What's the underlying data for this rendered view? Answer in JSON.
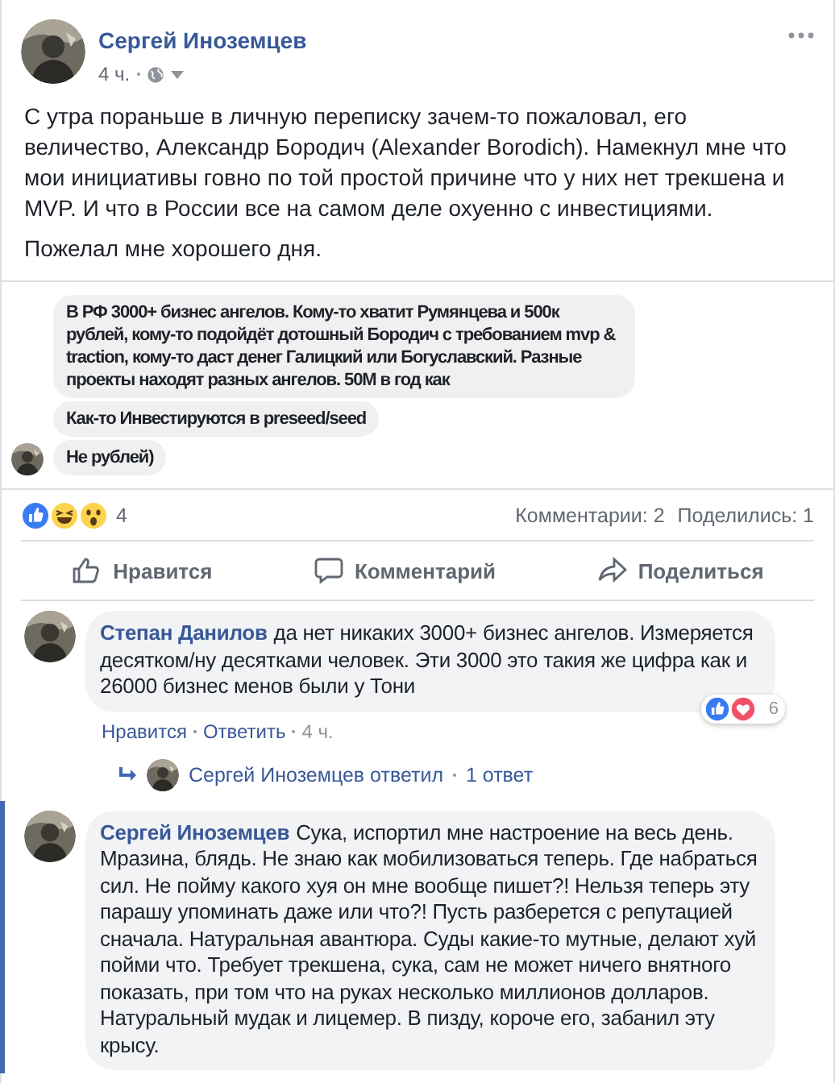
{
  "post": {
    "author": "Сергей Иноземцев",
    "time": "4 ч.",
    "paragraphs": [
      "С утра пораньше в личную переписку зачем-то пожаловал, его величество, Александр Бородич (Alexander Borodich). Намекнул мне что мои инициативы говно по той простой причине что у них нет трекшена и MVP. И что в России все на самом деле охуенно с инвестициями.",
      "Пожелал мне хорошего дня."
    ]
  },
  "embedded_chat": {
    "messages": [
      {
        "text": "В РФ 3000+ бизнес ангелов. Кому-то хватит Румянцева и 500к рублей, кому-то подойдёт дотошный Бородич с требованием mvp & traction, кому-то даст денег Галицкий или Богуславский. Разные проекты находят разных ангелов. 50M в год как",
        "show_avatar": false
      },
      {
        "text": "Как-то Инвестируются в preseed/seed",
        "show_avatar": false
      },
      {
        "text": "Не рублей)",
        "show_avatar": true
      }
    ]
  },
  "stats": {
    "reactions": [
      {
        "kind": "like"
      },
      {
        "kind": "haha"
      },
      {
        "kind": "wow"
      }
    ],
    "reaction_count": "4",
    "comments": "Комментарии: 2",
    "shares": "Поделились: 1"
  },
  "actions": [
    {
      "kind": "like",
      "label": "Нравится"
    },
    {
      "kind": "comment",
      "label": "Комментарий"
    },
    {
      "kind": "share",
      "label": "Поделиться"
    }
  ],
  "comments": [
    {
      "author": "Степан Данилов",
      "text": "да нет никаких 3000+ бизнес ангелов. Измеряется десятком/ну десятками человек. Эти 3000 это такия же цифра как и 26000 бизнес менов были у Тони",
      "highlighted": false,
      "links": [
        "Нравится",
        "Ответить",
        "4 ч."
      ],
      "reactions": [
        {
          "kind": "like"
        },
        {
          "kind": "love"
        }
      ],
      "reaction_count": "6",
      "reply_summary": {
        "text": "Сергей Иноземцев ответил",
        "count": "1 ответ"
      }
    },
    {
      "author": "Сергей Иноземцев",
      "text": "Сука, испортил мне настроение на весь день. Мразина, блядь. Не знаю как мобилизоваться теперь. Где набраться сил. Не пойму какого хуя он мне вообще пишет?! Нельзя теперь эту парашу упоминать даже или что?! Пусть разберется с репутацией сначала. Натуральная авантюра. Суды какие-то мутные, делают хуй пойми что. Требует трекшена, сука, сам не может ничего внятного показать, при том что на руках несколько миллионов долларов. Натуральный мудак и лицемер. В пизду, короче его, забанил эту крысу.",
      "highlighted": true
    }
  ]
}
